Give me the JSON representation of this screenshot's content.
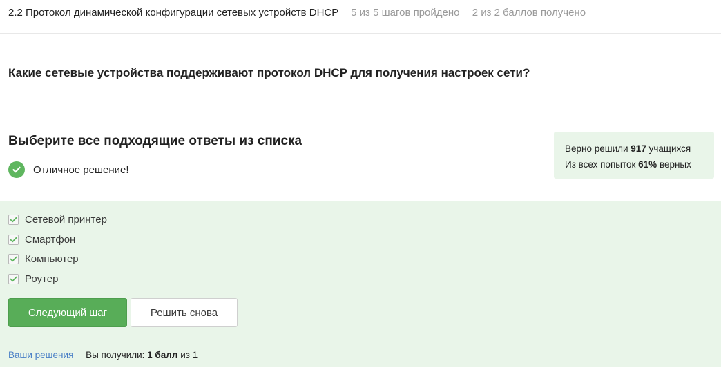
{
  "header": {
    "lesson_title": "2.2 Протокол динамической конфигурации сетевых устройств DHCP",
    "steps_progress": "5 из 5 шагов пройдено",
    "points_progress": "2 из 2 баллов  получено"
  },
  "question": "Какие сетевые устройства поддерживают протокол DHCP для получения настроек сети?",
  "task_title": "Выберите все подходящие ответы из списка",
  "feedback": {
    "text": "Отличное решение!",
    "icon": "check-circle-icon",
    "color": "#5fb65f"
  },
  "stats": {
    "solved_prefix": "Верно решили ",
    "solved_count": "917",
    "solved_suffix": " учащихся",
    "attempts_prefix": "Из всех попыток ",
    "attempts_percent": "61%",
    "attempts_suffix": " верных"
  },
  "options": [
    {
      "label": "Сетевой принтер",
      "checked": true
    },
    {
      "label": "Смартфон",
      "checked": true
    },
    {
      "label": "Компьютер",
      "checked": true
    },
    {
      "label": "Роутер",
      "checked": true
    }
  ],
  "buttons": {
    "next": "Следующий шаг",
    "retry": "Решить снова"
  },
  "footer": {
    "solutions_link": "Ваши решения",
    "score_prefix": "Вы получили: ",
    "score_value": "1 балл",
    "score_suffix": " из 1"
  },
  "colors": {
    "accent_green": "#58ad58",
    "success_bg": "#e9f5e9",
    "link_blue": "#4a7fc6"
  }
}
